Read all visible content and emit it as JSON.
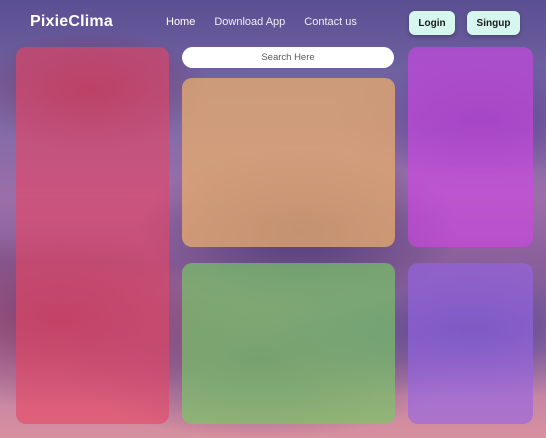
{
  "app": {
    "name": "PixieClima"
  },
  "nav": {
    "items": [
      "Home",
      "Download App",
      "Contact us"
    ],
    "active": "Home"
  },
  "auth": {
    "login_label": "Login",
    "signup_label": "Singup"
  },
  "search": {
    "placeholder": "Search Here"
  },
  "colors": {
    "card_red": "#e64664",
    "card_orange": "#e6aa6e",
    "card_magenta": "#d246e6",
    "card_green": "#78c864",
    "card_violet": "#9664e6",
    "button_bg": "#d6f7ee"
  }
}
